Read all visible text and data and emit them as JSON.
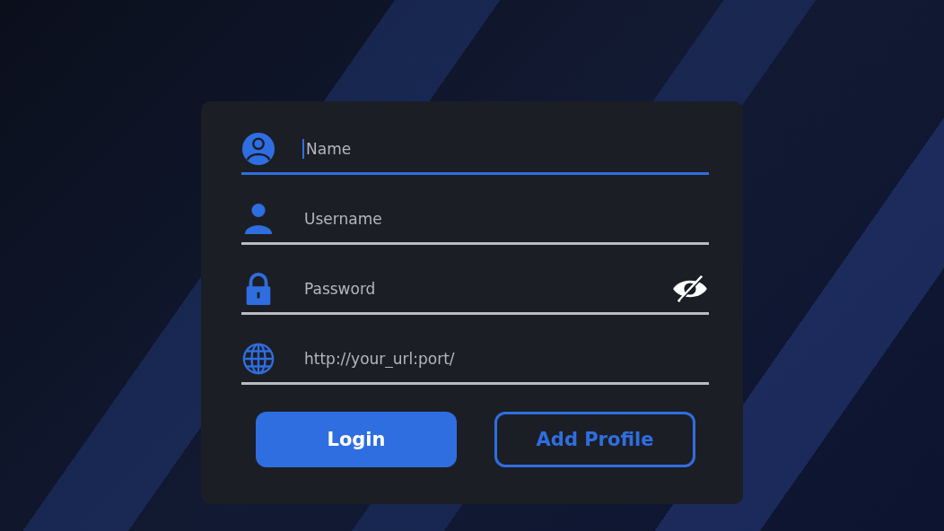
{
  "fields": [
    {
      "kind": "avatar",
      "placeholder": "Name",
      "focused": true
    },
    {
      "kind": "person",
      "placeholder": "Username",
      "focused": false
    },
    {
      "kind": "lock",
      "placeholder": "Password",
      "focused": false,
      "revealed": false
    },
    {
      "kind": "globe",
      "placeholder": "http://your_url:port/",
      "focused": false
    }
  ],
  "buttons": [
    {
      "kind": "primary",
      "label": "Login"
    },
    {
      "kind": "outline",
      "label": "Add Profile"
    }
  ]
}
